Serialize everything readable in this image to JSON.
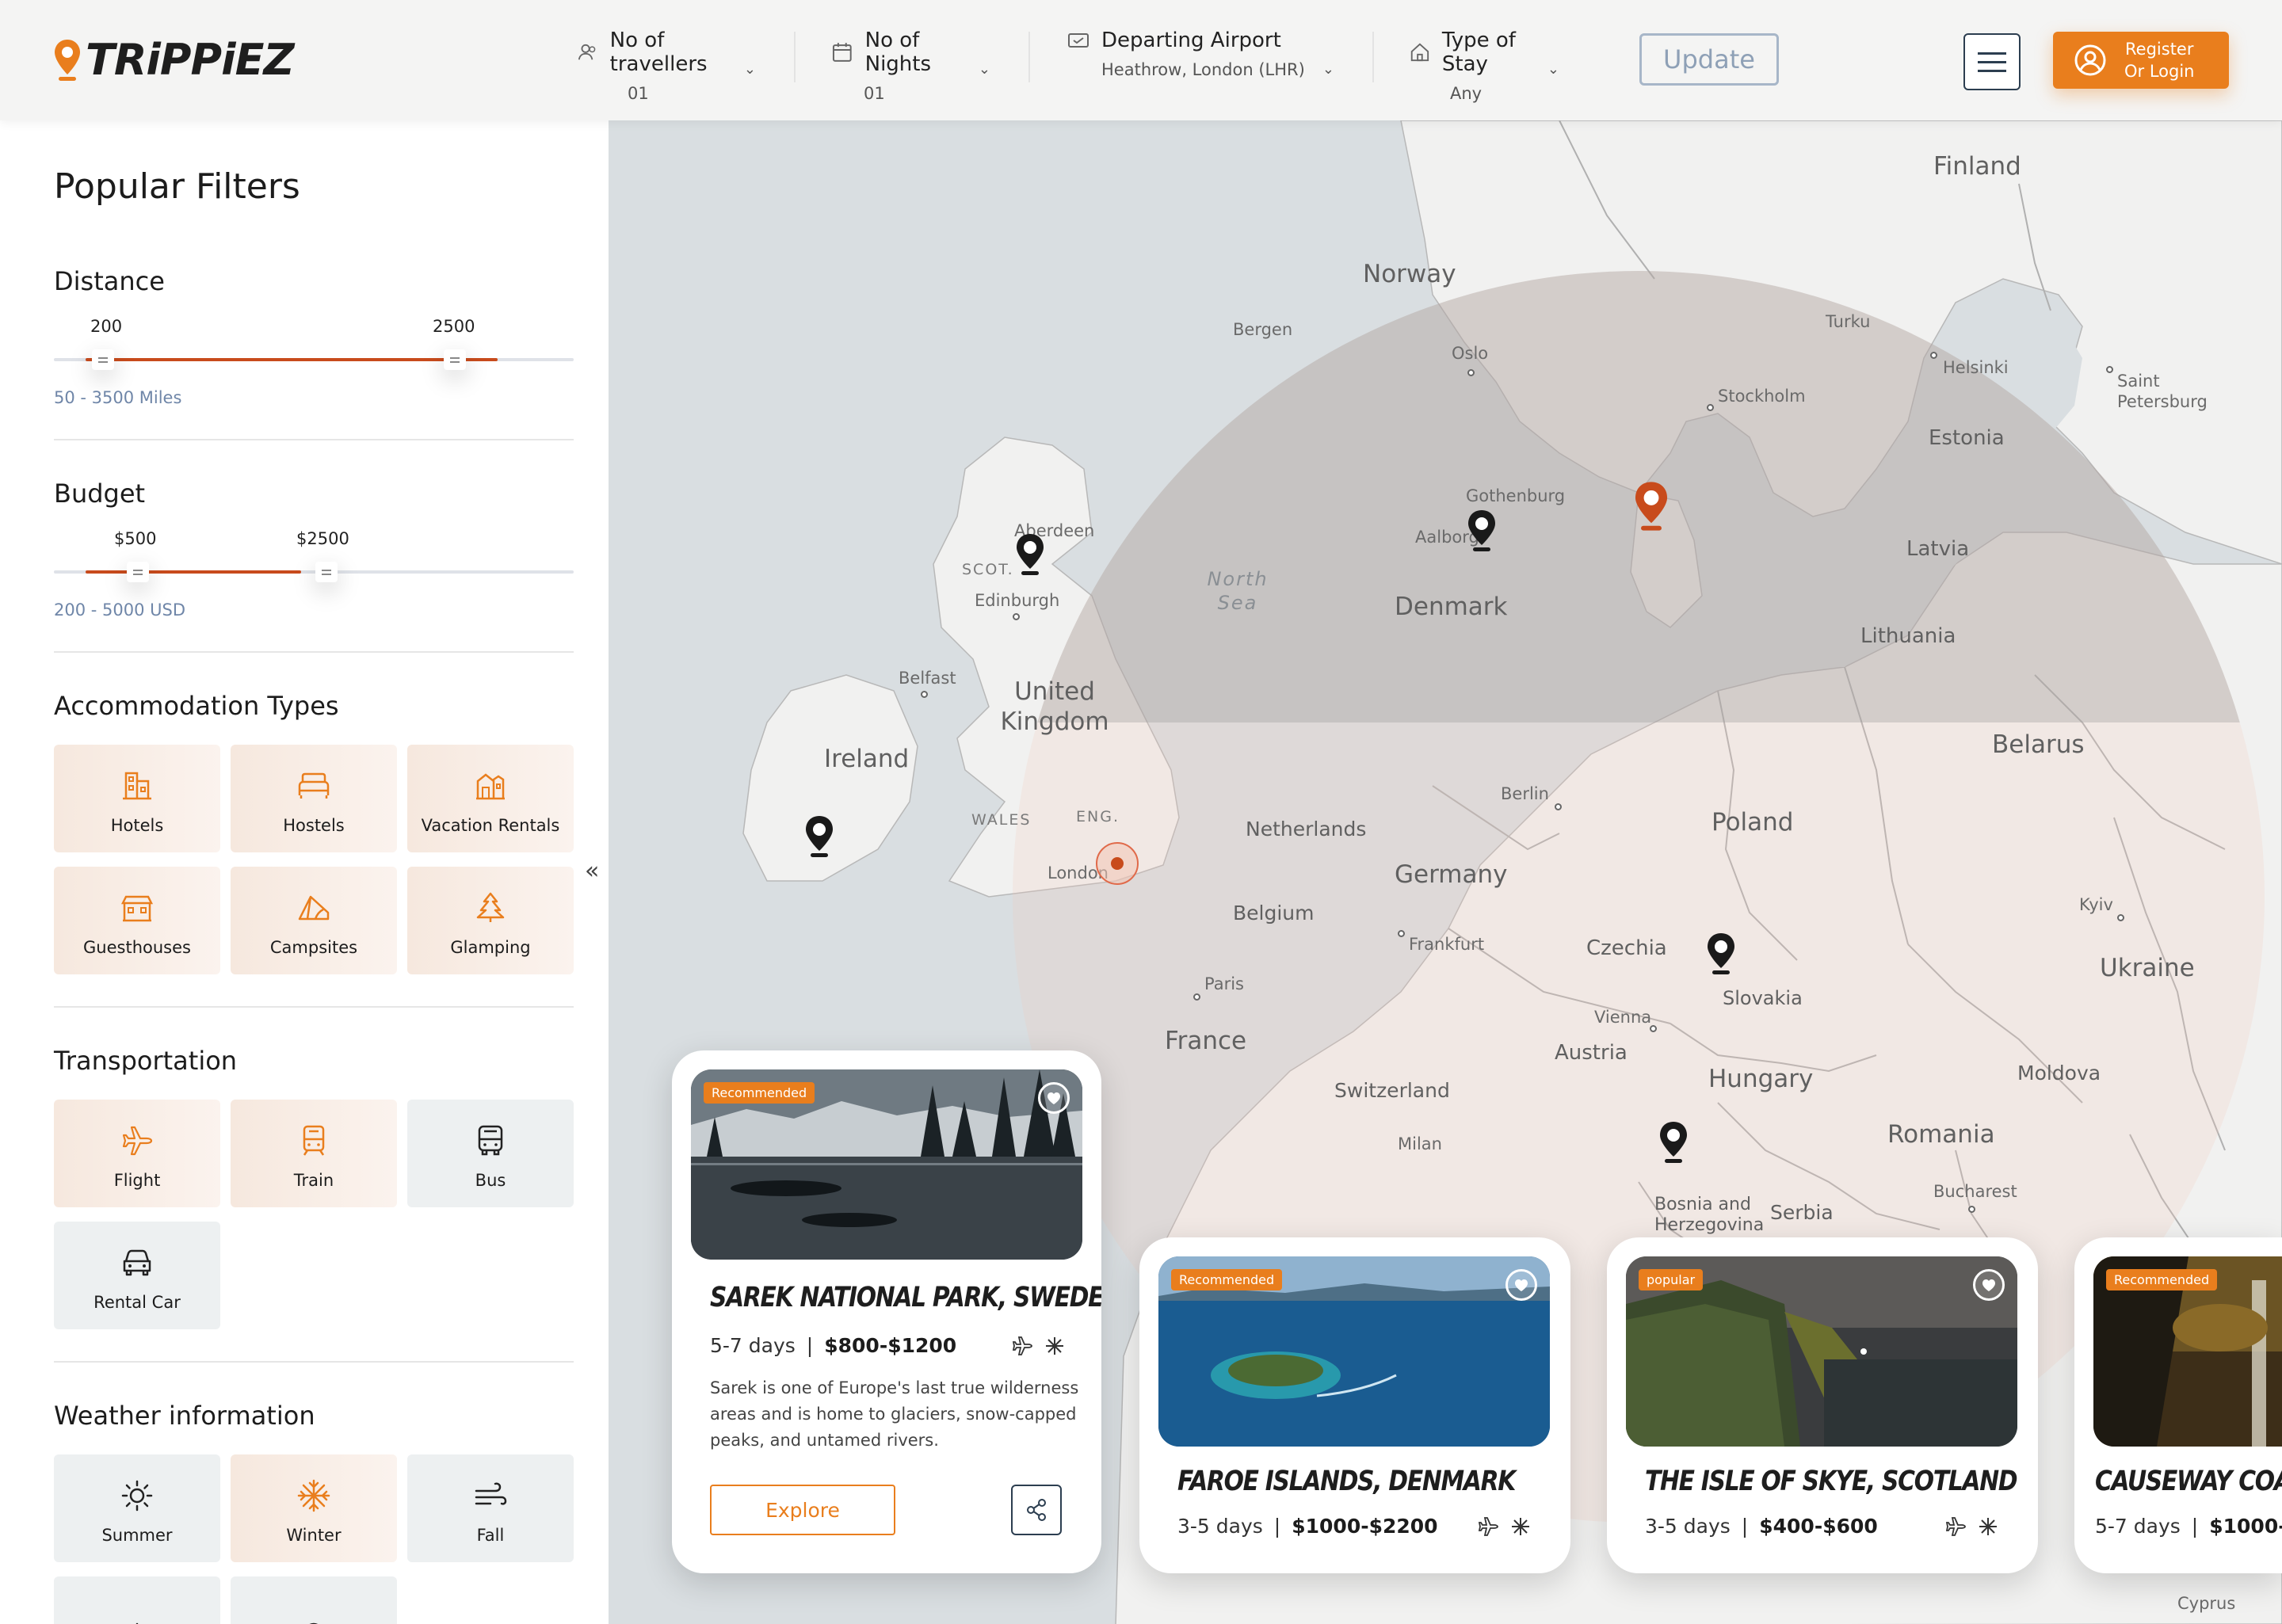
{
  "header": {
    "brand": "TRiPPiEZ",
    "travellers": {
      "label": "No of travellers",
      "value": "01"
    },
    "nights": {
      "label": "No of Nights",
      "value": "01"
    },
    "airport": {
      "label": "Departing Airport",
      "value": "Heathrow, London (LHR)"
    },
    "stay": {
      "label": "Type of Stay",
      "value": "Any"
    },
    "update_label": "Update",
    "register_line1": "Register",
    "register_line2": "Or Login"
  },
  "colors": {
    "accent": "#e97e1d",
    "slider": "#c84b1c",
    "warm_tile": "#f6e8de",
    "grey_tile": "#edf0f1"
  },
  "sidebar": {
    "title": "Popular Filters",
    "distance": {
      "title": "Distance",
      "min": "200",
      "max": "2500",
      "range": "50 - 3500 Miles",
      "low_fraction": 0.046,
      "high_fraction": 0.7
    },
    "budget": {
      "title": "Budget",
      "min": "$500",
      "max": "$2500",
      "range": "200 - 5000 USD",
      "low_fraction": 0.0625,
      "high_fraction": 0.479
    },
    "accommodation": {
      "title": "Accommodation Types",
      "items": [
        {
          "label": "Hotels",
          "icon": "hotel-icon"
        },
        {
          "label": "Hostels",
          "icon": "bed-icon"
        },
        {
          "label": "Vacation Rentals",
          "icon": "house-icon"
        },
        {
          "label": "Guesthouses",
          "icon": "guesthouse-icon"
        },
        {
          "label": "Campsites",
          "icon": "tent-icon"
        },
        {
          "label": "Glamping",
          "icon": "tree-icon"
        }
      ]
    },
    "transportation": {
      "title": "Transportation",
      "items": [
        {
          "label": "Flight",
          "icon": "plane-icon"
        },
        {
          "label": "Train",
          "icon": "train-icon"
        },
        {
          "label": "Bus",
          "icon": "bus-icon"
        },
        {
          "label": "Rental Car",
          "icon": "car-icon"
        }
      ]
    },
    "weather": {
      "title": "Weather information",
      "items": [
        {
          "label": "Summer",
          "icon": "sun-icon"
        },
        {
          "label": "Winter",
          "icon": "snowflake-icon"
        },
        {
          "label": "Fall",
          "icon": "wind-icon"
        }
      ]
    }
  },
  "map": {
    "countries": [
      "Finland",
      "Norway",
      "Estonia",
      "Latvia",
      "Lithuania",
      "Denmark",
      "United Kingdom",
      "Ireland",
      "Belarus",
      "Poland",
      "Netherlands",
      "Germany",
      "Belgium",
      "Czechia",
      "Slovakia",
      "Ukraine",
      "France",
      "Austria",
      "Hungary",
      "Switzerland",
      "Moldova",
      "Romania",
      "Serbia",
      "Bosnia and Herzegovina"
    ],
    "cities": [
      "Bergen",
      "Oslo",
      "Turku",
      "Helsinki",
      "Saint Petersburg",
      "Stockholm",
      "Gothenburg",
      "Aalborg",
      "Aberdeen",
      "Edinburgh",
      "Belfast",
      "London",
      "Berlin",
      "Frankfurt",
      "Paris",
      "Vienna",
      "Kyiv",
      "Milan",
      "Bucharest",
      "Cyprus"
    ],
    "regions": [
      "SCOT.",
      "WALES",
      "ENG."
    ],
    "sea": "North Sea"
  },
  "cards": [
    {
      "badge": "Recommended",
      "title": "SAREK NATIONAL PARK, SWEDEN",
      "days": "5-7 days",
      "price": "$800-$1200",
      "description": "Sarek is one of Europe's last true wilderness areas and is home to glaciers, snow-capped peaks, and untamed rivers.",
      "explore": "Explore"
    },
    {
      "badge": "Recommended",
      "title": "FAROE ISLANDS, DENMARK",
      "days": "3-5 days",
      "price": "$1000-$2200"
    },
    {
      "badge": "popular",
      "title": "THE ISLE OF SKYE, SCOTLAND",
      "days": "3-5 days",
      "price": "$400-$600"
    },
    {
      "badge": "Recommended",
      "title": "CAUSEWAY COAST",
      "days": "5-7 days",
      "price": "$1000-"
    }
  ]
}
